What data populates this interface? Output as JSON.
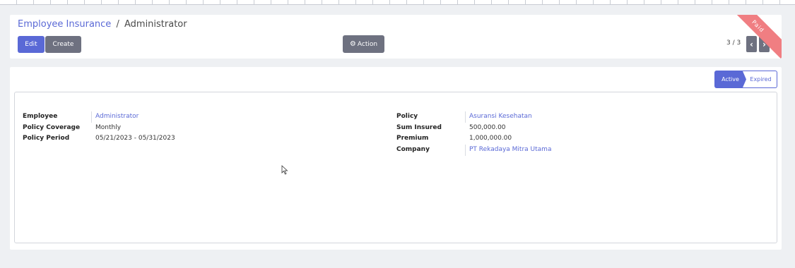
{
  "breadcrumb": {
    "parent": "Employee Insurance",
    "separator": "/",
    "current": "Administrator"
  },
  "toolbar": {
    "edit_label": "Edit",
    "create_label": "Create",
    "action_label": "Action",
    "pager_value": "3 / 3"
  },
  "ribbon": {
    "label": "Paid"
  },
  "status": {
    "active_label": "Active",
    "expired_label": "Expired"
  },
  "form": {
    "left": [
      {
        "label": "Employee",
        "value": "Administrator",
        "is_link": true
      },
      {
        "label": "Policy Coverage",
        "value": "Monthly",
        "is_link": false
      },
      {
        "label": "Policy Period",
        "value": "05/21/2023 - 05/31/2023",
        "is_link": false
      }
    ],
    "right": [
      {
        "label": "Policy",
        "value": "Asuransi Kesehatan",
        "is_link": true
      },
      {
        "label": "Sum Insured",
        "value": "500,000.00",
        "is_link": false
      },
      {
        "label": "Premium",
        "value": "1,000,000.00",
        "is_link": false
      },
      {
        "label": "Company",
        "value": "PT Rekadaya Mitra Utama",
        "is_link": true
      }
    ]
  },
  "colors": {
    "primary": "#5a69d6",
    "secondary": "#6e7180",
    "ribbon": "#f07e82"
  }
}
